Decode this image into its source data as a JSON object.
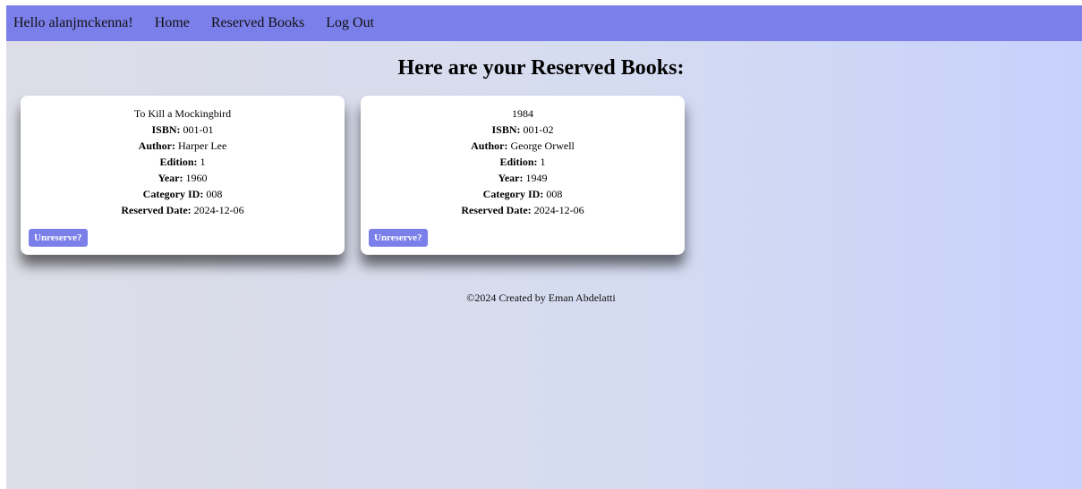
{
  "navbar": {
    "greeting": "Hello alanjmckenna!",
    "links": [
      "Home",
      "Reserved Books",
      "Log Out"
    ]
  },
  "page_title": "Here are your Reserved Books:",
  "books": [
    {
      "title": "To Kill a Mockingbird",
      "isbn_label": "ISBN:",
      "isbn": "001-01",
      "author_label": "Author:",
      "author": "Harper Lee",
      "edition_label": "Edition:",
      "edition": "1",
      "year_label": "Year:",
      "year": "1960",
      "category_label": "Category ID:",
      "category": "008",
      "reserved_label": "Reserved Date:",
      "reserved": "2024-12-06",
      "button": "Unreserve?"
    },
    {
      "title": "1984",
      "isbn_label": "ISBN:",
      "isbn": "001-02",
      "author_label": "Author:",
      "author": "George Orwell",
      "edition_label": "Edition:",
      "edition": "1",
      "year_label": "Year:",
      "year": "1949",
      "category_label": "Category ID:",
      "category": "008",
      "reserved_label": "Reserved Date:",
      "reserved": "2024-12-06",
      "button": "Unreserve?"
    }
  ],
  "footer": "©2024 Created by Eman Abdelatti",
  "colors": {
    "navbar": "#7b7fe9",
    "button": "#7b7fe9",
    "background_left": "#dcdde6",
    "background_right": "#c7d1fc"
  }
}
